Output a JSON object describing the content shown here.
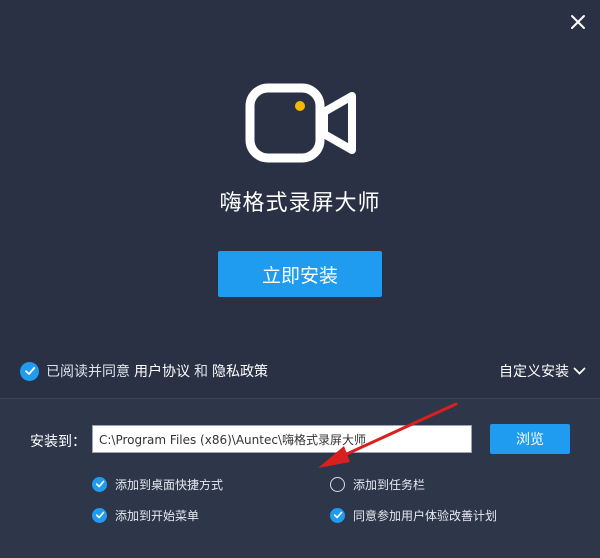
{
  "app": {
    "title": "嗨格式录屏大师"
  },
  "main": {
    "install_label": "立即安装"
  },
  "agreement": {
    "prefix": "已阅读并同意",
    "user_agreement": "用户协议",
    "and": "和",
    "privacy_policy": "隐私政策",
    "checked": true
  },
  "custom_install": {
    "label": "自定义安装"
  },
  "install_path": {
    "label": "安装到：",
    "value": "C:\\Program Files (x86)\\Auntec\\嗨格式录屏大师",
    "browse_label": "浏览"
  },
  "options": [
    {
      "label": "添加到桌面快捷方式",
      "checked": true
    },
    {
      "label": "添加到开始菜单",
      "checked": true
    },
    {
      "label": "添加到任务栏",
      "checked": false
    },
    {
      "label": "同意参加用户体验改善计划",
      "checked": true
    }
  ],
  "colors": {
    "accent": "#1f9bf0",
    "background": "#2a3144",
    "logo_dot": "#f5b800",
    "annotation_arrow": "#d9201f"
  },
  "icons": {
    "close": "close-icon",
    "logo": "video-camera-icon",
    "dropdown": "chevron-down-icon",
    "check": "check-icon"
  }
}
